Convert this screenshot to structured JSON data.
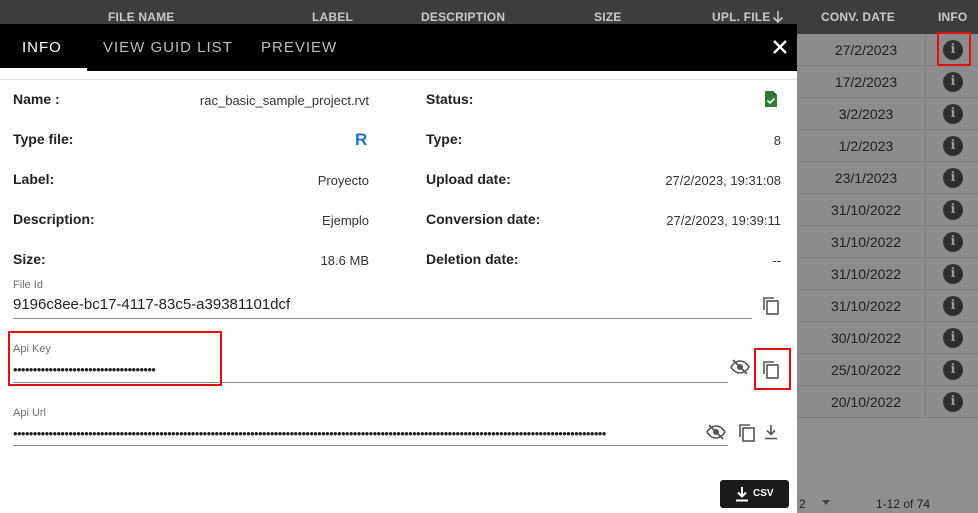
{
  "table": {
    "columns": [
      "FILE NAME",
      "LABEL",
      "DESCRIPTION",
      "SIZE",
      "UPL. FILE",
      "CONV. DATE",
      "INFO"
    ],
    "sort_icon": "arrow-down-icon",
    "conv_dates": [
      "27/2/2023",
      "17/2/2023",
      "3/2/2023",
      "1/2/2023",
      "23/1/2023",
      "31/10/2022",
      "31/10/2022",
      "31/10/2022",
      "31/10/2022",
      "30/10/2022",
      "25/10/2022",
      "20/10/2022"
    ],
    "info_icon": "info-icon",
    "pagination": {
      "page": "2",
      "range": "1-12 of 74"
    }
  },
  "modal": {
    "tabs": [
      "INFO",
      "VIEW GUID LIST",
      "PREVIEW"
    ],
    "active_tab": "INFO",
    "close_icon": "close-icon",
    "details": {
      "name_label": "Name :",
      "name_value": "rac_basic_sample_project.rvt",
      "type_label": "Type file:",
      "type_value": "R",
      "label_label": "Label:",
      "label_value": "Proyecto",
      "desc_label": "Description:",
      "desc_value": "Ejemplo",
      "size_label": "Size:",
      "size_value": "18.6 MB",
      "status_label": "Status:",
      "status_icon": "file-check-icon",
      "type2_label": "Type:",
      "type2_value": "8",
      "upload_label": "Upload date:",
      "upload_value": "27/2/2023, 19:31:08",
      "conversion_label": "Conversion date:",
      "conversion_value": "27/2/2023, 19:39:11",
      "deletion_label": "Deletion date:",
      "deletion_value": "--"
    },
    "fields": {
      "file_id_label": "File Id",
      "file_id_value": "9196c8ee-bc17-4117-83c5-a39381101dcf",
      "api_key_label": "Api Key",
      "api_key_value": "••••••••••••••••••••••••••••••••••••",
      "api_url_label": "Api Url",
      "api_url_value": "••••••••••••••••••••••••••••••••••••••••••••••••••••••••••••••••••••••••••••••••••••••••••••••••••••••••••••••••••••••••••••••••••••••••••••••••••••••"
    },
    "csv_button": "CSV",
    "colors": {
      "accent": "#000000",
      "highlight": "#e01010",
      "status": "#2e7d32",
      "revit": "#1e6fd0"
    }
  }
}
